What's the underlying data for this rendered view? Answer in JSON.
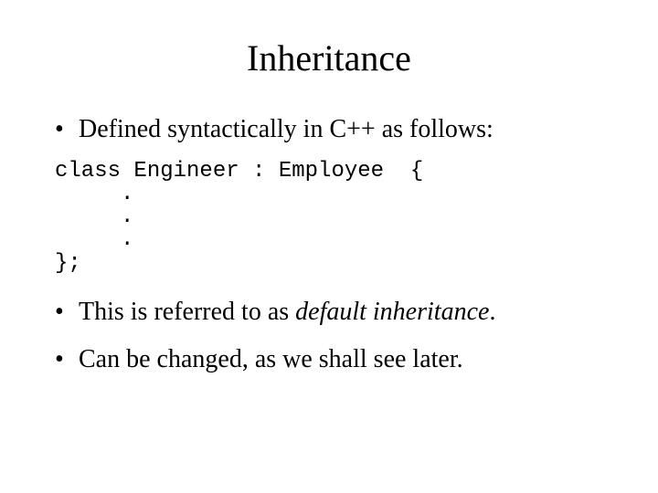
{
  "title": "Inheritance",
  "bullet1": "Defined syntactically in C++ as follows:",
  "code": "class Engineer : Employee  {\n     .\n     .\n     .\n};",
  "bullet2_pre": "This is referred to as ",
  "bullet2_italic": "default inheritance",
  "bullet2_post": ".",
  "bullet3": "Can be changed, as we shall see later."
}
